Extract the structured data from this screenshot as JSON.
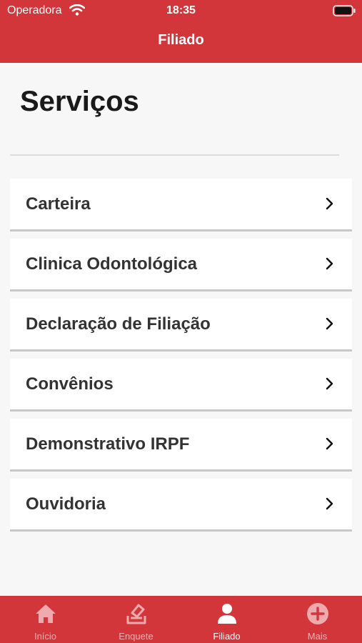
{
  "status_bar": {
    "carrier": "Operadora",
    "time": "18:35"
  },
  "nav": {
    "title": "Filiado"
  },
  "page": {
    "title": "Serviços"
  },
  "services": [
    {
      "label": "Carteira"
    },
    {
      "label": "Clinica Odontológica"
    },
    {
      "label": "Declaração de Filiação"
    },
    {
      "label": "Convênios"
    },
    {
      "label": "Demonstrativo IRPF"
    },
    {
      "label": "Ouvidoria"
    }
  ],
  "tabs": [
    {
      "label": "Início",
      "icon": "home-icon",
      "active": false
    },
    {
      "label": "Enquete",
      "icon": "ballot-icon",
      "active": false
    },
    {
      "label": "Filiado",
      "icon": "person-icon",
      "active": true
    },
    {
      "label": "Mais",
      "icon": "plus-circle-icon",
      "active": false
    }
  ],
  "colors": {
    "brand": "#d2363b",
    "background": "#f7f7f7",
    "text": "#333333"
  }
}
